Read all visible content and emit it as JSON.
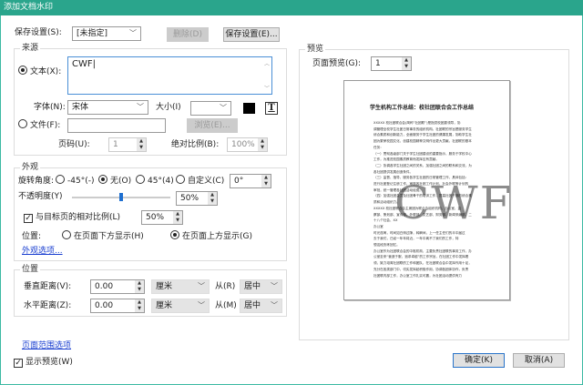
{
  "window": {
    "title": "添加文档水印"
  },
  "top": {
    "save_settings_label": "保存设置(S):",
    "save_settings_value": "[未指定]",
    "delete_label": "删除(D)",
    "save_button_label": "保存设置(E)..."
  },
  "source": {
    "title": "来源",
    "text_label": "文本(X):",
    "text_value": "CWF",
    "font_label": "字体(N):",
    "font_value": "宋体",
    "size_label": "大小(I)",
    "size_value": "",
    "color": "#000000",
    "file_label": "文件(F):",
    "file_value": "",
    "browse_label": "浏览(E)...",
    "page_label": "页码(U):",
    "page_value": "1",
    "abs_scale_label": "绝对比例(B):",
    "abs_scale_value": "100%"
  },
  "appearance": {
    "title": "外观",
    "rotation_label": "旋转角度:",
    "rot_options": [
      "-45°(-)",
      "无(O)",
      "45°(4)",
      "自定义(C)"
    ],
    "rot_selected": "无(O)",
    "rot_custom_value": "0°",
    "opacity_label": "不透明度(Y)",
    "opacity_value": "50%",
    "opacity": 0.5,
    "relative_label": "与目标页的相对比例(L)",
    "relative_checked": true,
    "relative_value": "50%",
    "position_label": "位置:",
    "pos_below": "在页面下方显示(H)",
    "pos_above": "在页面上方显示(G)",
    "pos_selected": "above",
    "options_link": "外观选项..."
  },
  "position": {
    "title": "位置",
    "vertical_label": "垂直距离(V):",
    "vertical_value": "0.00",
    "vertical_unit": "厘米",
    "from_r_label": "从(R)",
    "from_r_value": "居中",
    "horizontal_label": "水平距离(Z):",
    "horizontal_value": "0.00",
    "horizontal_unit": "厘米",
    "from_m_label": "从(M)",
    "from_m_value": "居中"
  },
  "page_range_link": "页面范围选项",
  "show_preview_label": "显示预览(W)",
  "preview": {
    "title": "预览",
    "page_label": "页面预览(G):",
    "page_value": "1",
    "doc_title": "学生机构工作总结：校社团联合会工作总结",
    "doc_lines": [
      "XXXXX 校社团联合会(简称“社团联”)是指党校团委领导，协",
      "调管理全校学生社团日常事务的组织机构。社团联的宗旨是服务学生",
      "综合素质和创新能力，全面服务于学生社团的健康发展，协助学生社",
      "团为繁荣校园文化、创建校园精神文明作出更大贡献。社团联的基本",
      "任务：",
      "（一）贯彻各级部门关于学生社团建设的重要指示，服务于学校中心",
      "工作，为推进校园素质教育而发挥应有贡献。",
      "（二）协调各学生社团之间的关系，加强社团之间的联系和交流，为",
      "各社团提供发展创造条件。",
      "（三）监督、指导、服务各学生社团的日常管理工作，具体包括：",
      "进行社团登记注册工作，审核各社团工作计划，社会外联等计划的",
      "审批，统一管理各社团活动经费。",
      "（四）加强社团会员及社团骨干的培训工作，提高社团干部的综合素",
      "质和活动组织力。",
      "XXXXX 校社团联合会主席团为联合会组织机构，办公室、监",
      "察部、策划部、宣传部、外联部、文艺部、财务部、新闻采编部，二",
      "十八个社会、XX",
      "办公室",
      "时光荏苒，时间如白驹过隙，转瞬间，上一任主任们的半中届过",
      "去于我们，已经一年年将近，一年中离不了我们的工作，特",
      "想这段历练回忆。",
      "办公室作为社团联合会的中枢机构，主要负责社团联的事务工作，办",
      "公室至来“营造于服，追求卓越”的工作宗旨，在社团工作中发挥着",
      "领，致力培育社团联的工作和团队，在社团联合会中发挥作用十足，",
      "充分在各类部门中，切实发挥起积极作用，协调各团体协作，负责",
      "社团联内部工作，办公室工作扎实可靠，为社团活动提供有力"
    ],
    "watermark_text": "CWF"
  },
  "buttons": {
    "ok": "确定(K)",
    "cancel": "取消(A)"
  }
}
